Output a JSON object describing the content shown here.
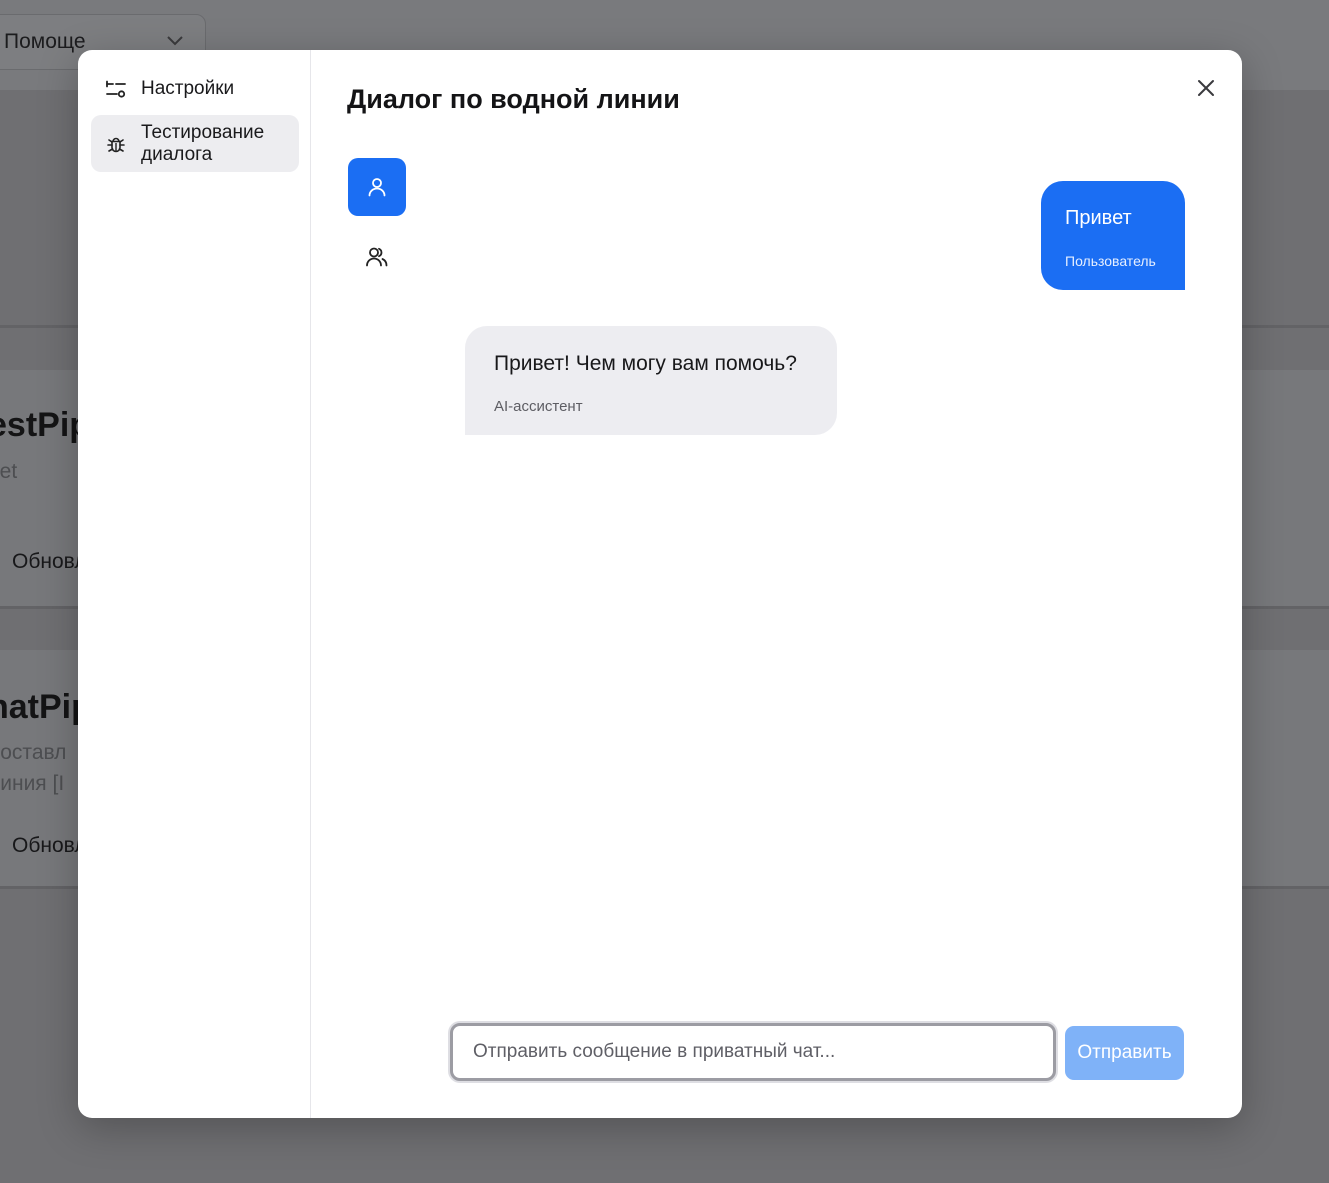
{
  "background": {
    "select_label": "Помоще",
    "cards": [
      {
        "title": "estPip",
        "subtitle": "net",
        "subtitle2": "",
        "button": "Обновл"
      },
      {
        "title": "hatPip",
        "subtitle": "доставл",
        "subtitle2": "линия [I",
        "button": "Обновл"
      }
    ]
  },
  "modal": {
    "title": "Диалог по водной линии",
    "sidebar": {
      "items": [
        {
          "label": "Настройки",
          "icon": "sliders-icon",
          "active": false
        },
        {
          "label": "Тестирование диалога",
          "icon": "bug-icon",
          "active": true
        }
      ]
    },
    "roles": [
      {
        "icon": "user-icon",
        "active": true
      },
      {
        "icon": "users-icon",
        "active": false
      }
    ],
    "messages": [
      {
        "text": "Привет",
        "author": "Пользователь",
        "side": "right"
      },
      {
        "text": "Привет! Чем могу вам помочь?",
        "author": "AI-ассистент",
        "side": "left"
      }
    ],
    "input": {
      "value": "",
      "placeholder": "Отправить сообщение в приватный чат..."
    },
    "send_label": "Отправить"
  },
  "colors": {
    "accent": "#1b6ef3",
    "send_disabled": "#7fb2f8",
    "overlay": "#6f6f72"
  }
}
